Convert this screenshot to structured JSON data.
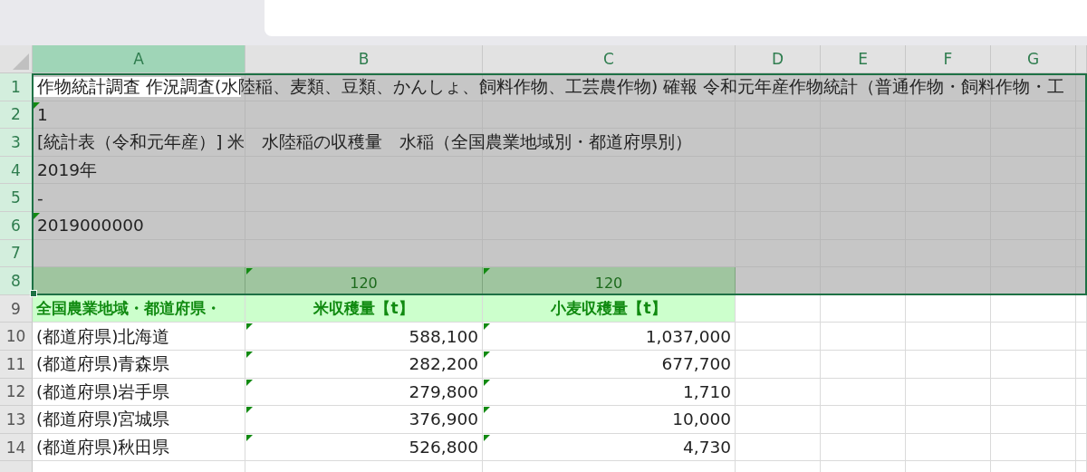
{
  "columns": [
    {
      "label": "A",
      "selected": true
    },
    {
      "label": "B",
      "selected": false
    },
    {
      "label": "C",
      "selected": false
    },
    {
      "label": "D",
      "selected": false
    },
    {
      "label": "E",
      "selected": false
    },
    {
      "label": "F",
      "selected": false
    },
    {
      "label": "G",
      "selected": false
    }
  ],
  "rows": [
    {
      "number": "1",
      "selected": true,
      "kind": "text",
      "cells": [
        {
          "text": "作物統計調査 作況調査(水陸稲、麦類、豆類、かんしょ、飼料作物、工芸農作物) 確報 令和元年産作物統計（普通作物・飼料作物・工",
          "active": true
        }
      ]
    },
    {
      "number": "2",
      "selected": true,
      "kind": "text",
      "cells": [
        {
          "text": "1",
          "flag": true
        }
      ]
    },
    {
      "number": "3",
      "selected": true,
      "kind": "text",
      "cells": [
        {
          "text": "[統計表（令和元年産）] 米　水陸稲の収穫量　水稲（全国農業地域別・都道府県別）"
        }
      ]
    },
    {
      "number": "4",
      "selected": true,
      "kind": "text",
      "cells": [
        {
          "text": "2019年"
        }
      ]
    },
    {
      "number": "5",
      "selected": true,
      "kind": "text",
      "cells": [
        {
          "text": "-"
        }
      ]
    },
    {
      "number": "6",
      "selected": true,
      "kind": "text",
      "cells": [
        {
          "text": "2019000000",
          "flag": true
        }
      ]
    },
    {
      "number": "7",
      "selected": true,
      "kind": "text",
      "cells": []
    },
    {
      "number": "8",
      "selected": true,
      "kind": "band",
      "cells": [
        {},
        {
          "text": "120",
          "flag": true
        },
        {
          "text": "120",
          "flag": true
        }
      ]
    },
    {
      "number": "9",
      "selected": false,
      "kind": "header",
      "cells": [
        {
          "text": "全国農業地域・都道府県・"
        },
        {
          "text": "米収穫量【t】"
        },
        {
          "text": "小麦収穫量【t】"
        }
      ]
    },
    {
      "number": "10",
      "selected": false,
      "kind": "data",
      "cells": [
        {
          "text": "(都道府県)北海道"
        },
        {
          "text": "588,100",
          "flag": true
        },
        {
          "text": "1,037,000",
          "flag": true
        }
      ]
    },
    {
      "number": "11",
      "selected": false,
      "kind": "data",
      "cells": [
        {
          "text": "(都道府県)青森県"
        },
        {
          "text": "282,200",
          "flag": true
        },
        {
          "text": "677,700",
          "flag": true
        }
      ]
    },
    {
      "number": "12",
      "selected": false,
      "kind": "data",
      "cells": [
        {
          "text": "(都道府県)岩手県"
        },
        {
          "text": "279,800",
          "flag": true
        },
        {
          "text": "1,710",
          "flag": true
        }
      ]
    },
    {
      "number": "13",
      "selected": false,
      "kind": "data",
      "cells": [
        {
          "text": "(都道府県)宮城県"
        },
        {
          "text": "376,900",
          "flag": true
        },
        {
          "text": "10,000",
          "flag": true
        }
      ]
    },
    {
      "number": "14",
      "selected": false,
      "kind": "data",
      "cells": [
        {
          "text": "(都道府県)秋田県"
        },
        {
          "text": "526,800",
          "flag": true
        },
        {
          "text": "4,730",
          "flag": true
        }
      ]
    }
  ]
}
